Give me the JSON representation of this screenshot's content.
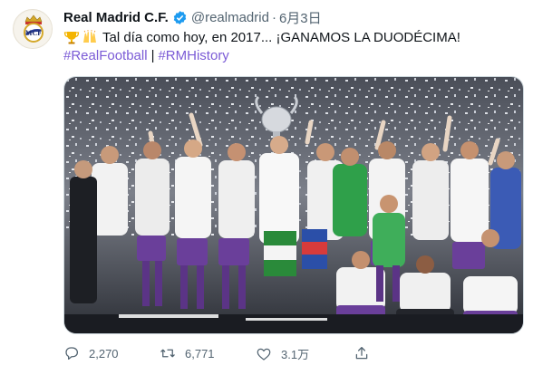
{
  "tweet": {
    "display_name": "Real Madrid C.F.",
    "handle": "@realmadrid",
    "separator": "·",
    "date": "6月3日",
    "emojis": [
      "trophy-emoji",
      "raised-hands-emoji"
    ],
    "text": "Tal día como hoy, en 2017... ¡GANAMOS LA DUODÉCIMA!",
    "hashtags": [
      "#RealFootball",
      "#RMHistory"
    ],
    "hashtag_separator": "|"
  },
  "actions": {
    "reply_count": "2,270",
    "retweet_count": "6,771",
    "like_count": "3.1万"
  },
  "colors": {
    "hashtag": "#7b5bd6",
    "verified": "#1d9bf0",
    "muted": "#536471"
  }
}
